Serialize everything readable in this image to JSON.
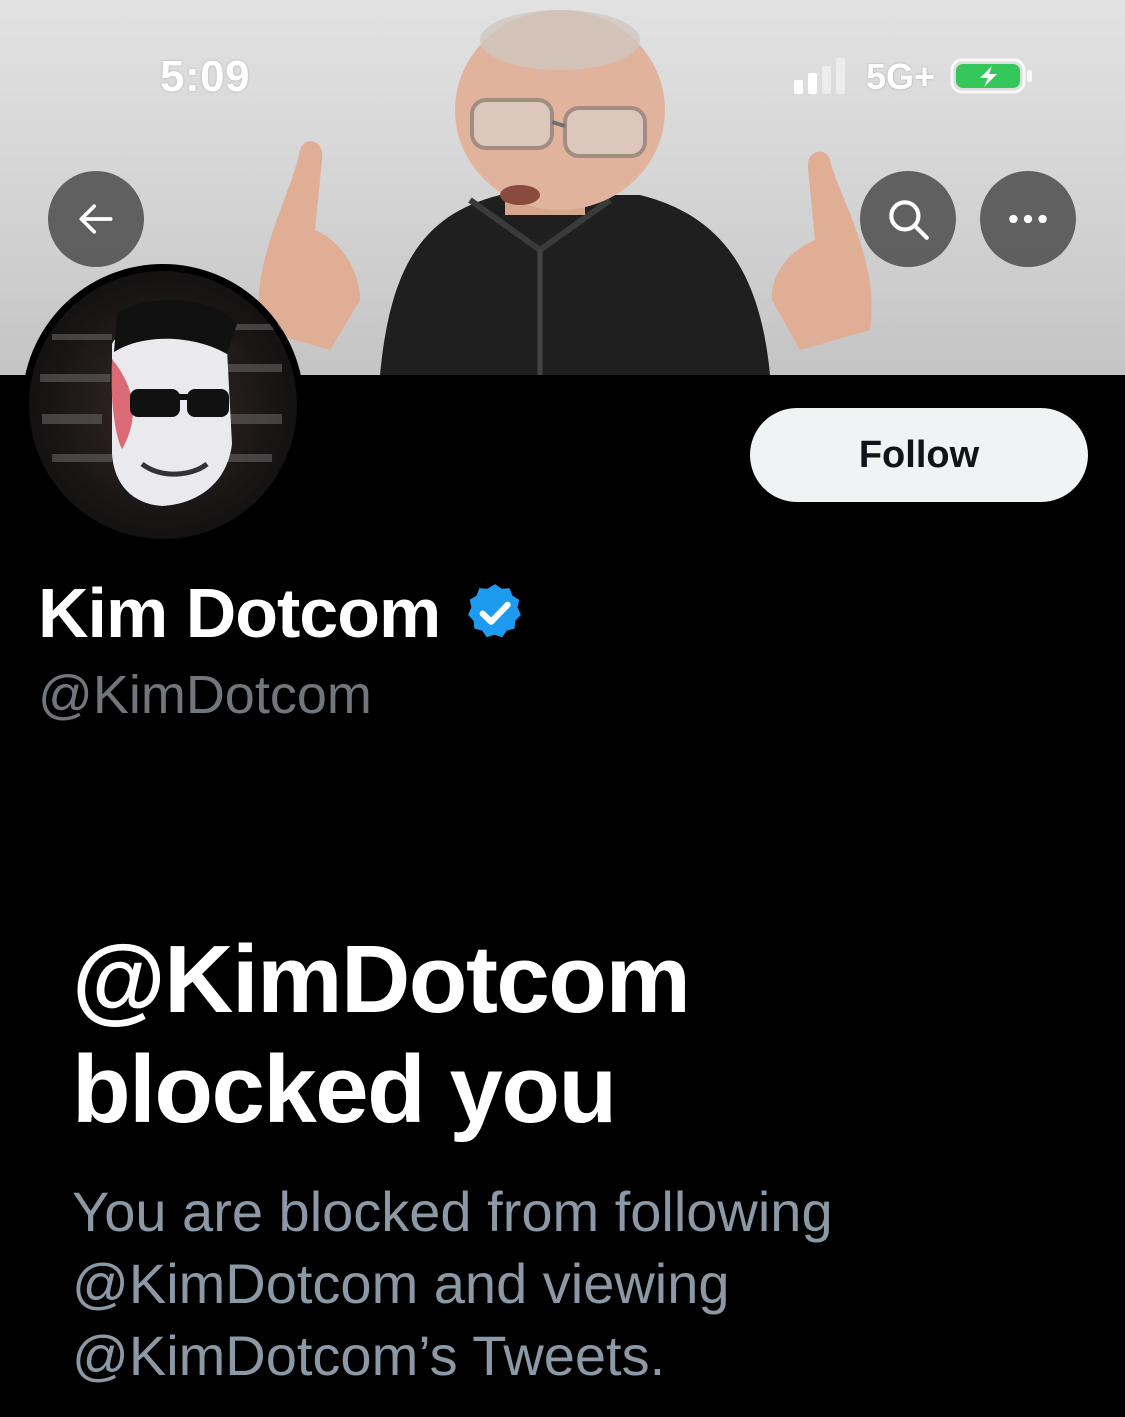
{
  "status_bar": {
    "time": "5:09",
    "network": "5G+",
    "battery_state": "charging"
  },
  "banner": {
    "back_icon": "arrow-left-icon",
    "search_icon": "search-icon",
    "more_icon": "more-horizontal-icon"
  },
  "profile": {
    "display_name": "Kim Dotcom",
    "handle": "@KimDotcom",
    "verified": true,
    "verified_color": "#1d9bf0",
    "follow_label": "Follow"
  },
  "blocked": {
    "title_line1": "@KimDotcom",
    "title_line2": "blocked you",
    "desc_line1": "You are blocked from following",
    "desc_line2": "@KimDotcom and viewing",
    "desc_line3": "@KimDotcom’s Tweets."
  },
  "colors": {
    "background": "#000000",
    "secondary_text": "#71767b",
    "follow_button_bg": "#eff3f4"
  }
}
